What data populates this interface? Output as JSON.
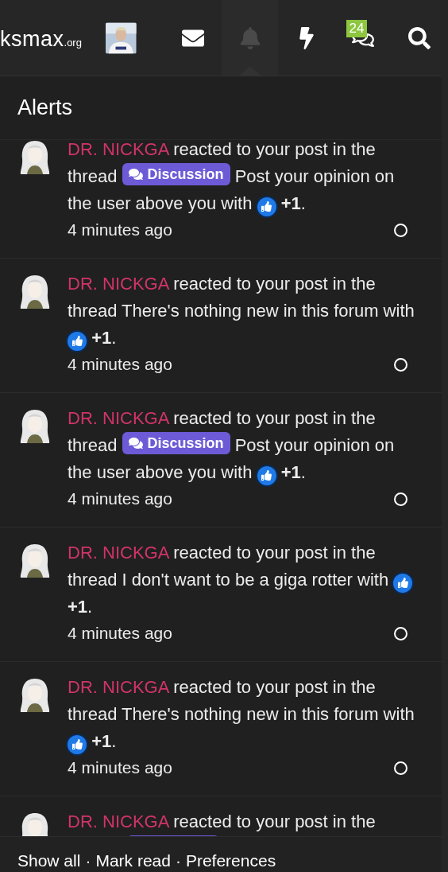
{
  "header": {
    "logo": {
      "name": "ksmax",
      "suffix": ".org"
    },
    "nav": [
      {
        "kind": "envelope",
        "selected": false
      },
      {
        "kind": "bell",
        "selected": true
      },
      {
        "kind": "bolt",
        "selected": false
      },
      {
        "kind": "chat",
        "selected": false,
        "badge": "24"
      },
      {
        "kind": "search",
        "selected": false
      }
    ]
  },
  "panel": {
    "title": "Alerts",
    "alerts": [
      {
        "kind": "full",
        "user": "DR. NICKGA",
        "action": "reacted to your post in the thread",
        "prefix": "Discussion",
        "title": "Post your opinion on the user above you",
        "with": "with",
        "reaction": "**+1**.",
        "time": "4 minutes ago",
        "read": false
      },
      {
        "kind": "full",
        "user": "DR. NICKGA",
        "action": "reacted to your post in the thread",
        "title": "There's nothing new in this forum",
        "with": "with",
        "reaction": "**+1**.",
        "time": "4 minutes ago",
        "read": false
      },
      {
        "kind": "full",
        "user": "DR. NICKGA",
        "action": "reacted to your post in the thread",
        "prefix": "Discussion",
        "title": "Post your opinion on the user above you",
        "with": "with",
        "reaction": "**+1**.",
        "time": "4 minutes ago",
        "read": false
      },
      {
        "kind": "full",
        "user": "DR. NICKGA",
        "action": "reacted to your post in the thread",
        "title": "I don't want to be a giga rotter",
        "with": "with",
        "reaction": "**+1**.",
        "time": "4 minutes ago",
        "read": false
      },
      {
        "kind": "full",
        "user": "DR. NICKGA",
        "action": "reacted to your post in the thread",
        "title": "There's nothing new in this forum",
        "with": "with",
        "reaction": "**+1**.",
        "time": "4 minutes ago",
        "read": false
      },
      {
        "kind": "partial",
        "user": "DR. NICKGA",
        "action": "reacted to your post in the"
      }
    ],
    "footer": {
      "links": [
        "Show all",
        "Mark read",
        "Preferences"
      ],
      "separator": "·"
    }
  }
}
